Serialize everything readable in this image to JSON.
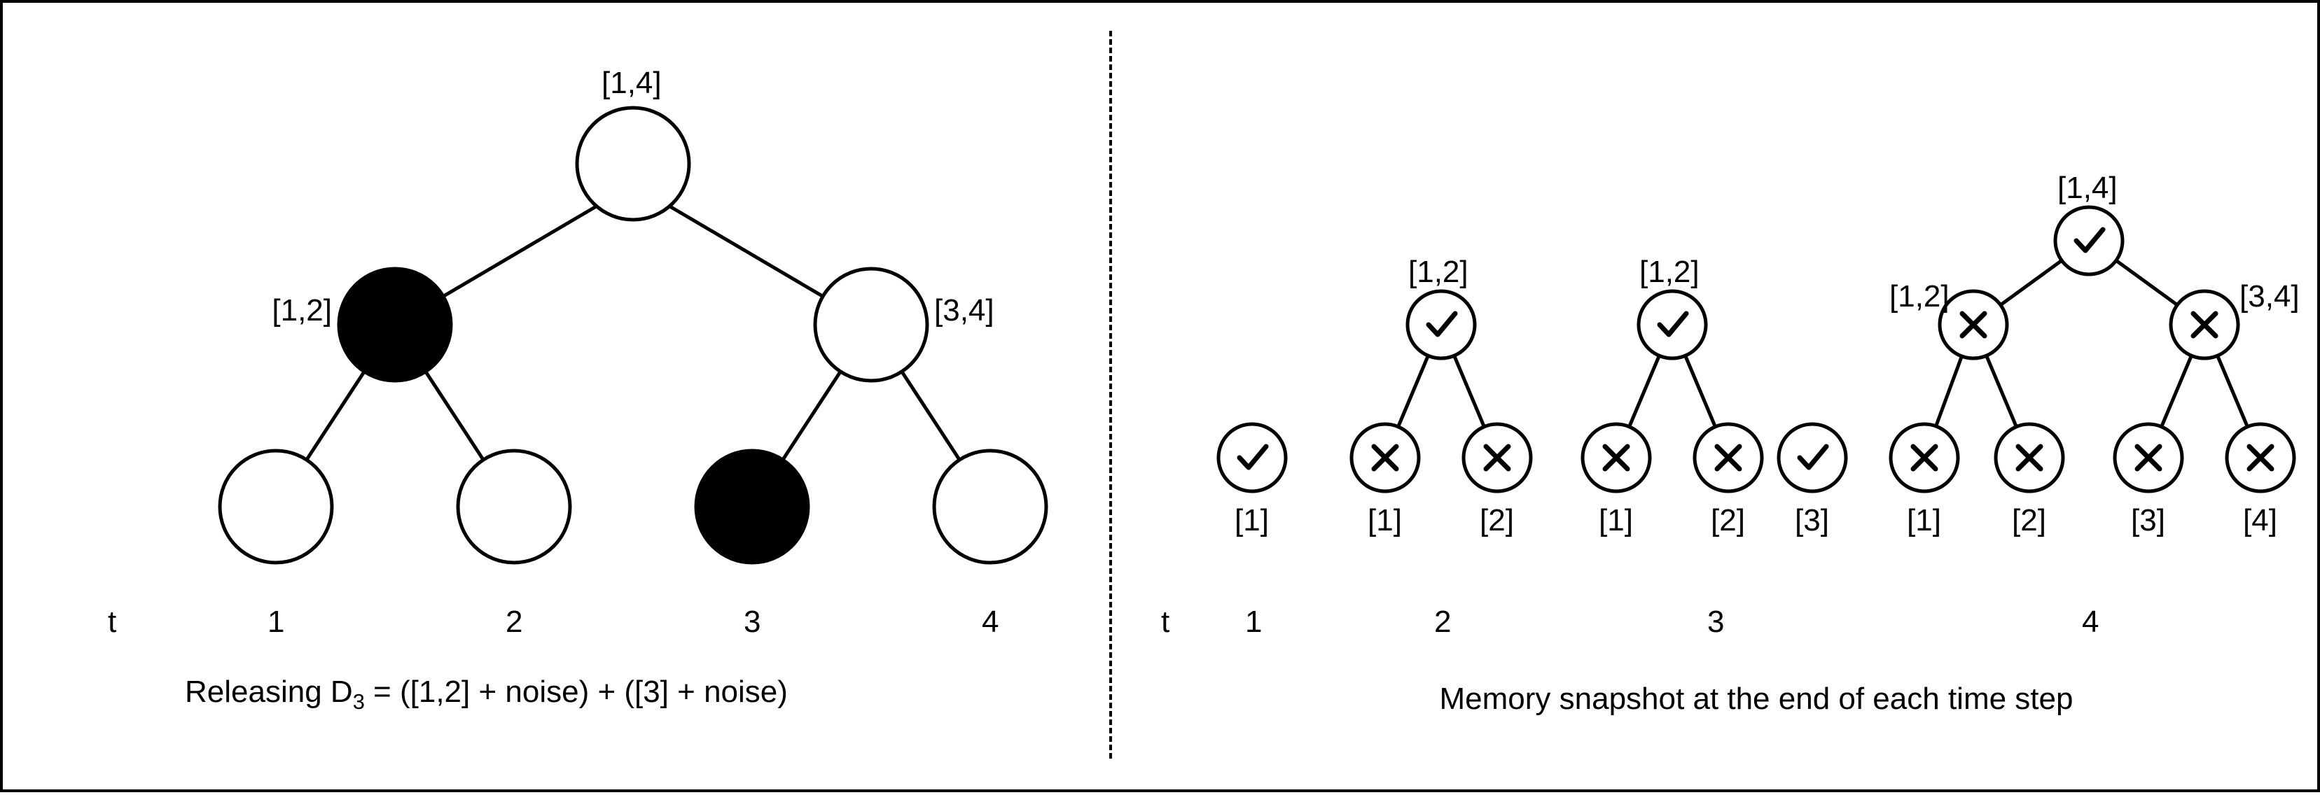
{
  "left": {
    "root_label": "[1,4]",
    "mid_left_label": "[1,2]",
    "mid_right_label": "[3,4]",
    "t_label": "t",
    "t1": "1",
    "t2": "2",
    "t3": "3",
    "t4": "4",
    "caption_prefix": "Releasing D",
    "caption_sub": "3",
    "caption_suffix": " = ([1,2] + noise) + ([3] + noise)",
    "nodes": {
      "root": {
        "filled": false
      },
      "m_l": {
        "filled": true
      },
      "m_r": {
        "filled": false
      },
      "leaf1": {
        "filled": false
      },
      "leaf2": {
        "filled": false
      },
      "leaf3": {
        "filled": true
      },
      "leaf4": {
        "filled": false
      }
    }
  },
  "right": {
    "t_label": "t",
    "t1": "1",
    "t2": "2",
    "t3": "3",
    "t4": "4",
    "caption": "Memory snapshot at the end of each time step",
    "snap1": {
      "leaf1": {
        "label": "[1]",
        "mark": "check"
      }
    },
    "snap2": {
      "top": {
        "label": "[1,2]",
        "mark": "check"
      },
      "leaf1": {
        "label": "[1]",
        "mark": "x"
      },
      "leaf2": {
        "label": "[2]",
        "mark": "x"
      }
    },
    "snap3": {
      "top": {
        "label": "[1,2]",
        "mark": "check"
      },
      "leaf1": {
        "label": "[1]",
        "mark": "x"
      },
      "leaf2": {
        "label": "[2]",
        "mark": "x"
      },
      "leaf3": {
        "label": "[3]",
        "mark": "check"
      }
    },
    "snap4": {
      "root": {
        "label": "[1,4]",
        "mark": "check"
      },
      "m_l": {
        "label": "[1,2]",
        "mark": "x"
      },
      "m_r": {
        "label": "[3,4]",
        "mark": "x"
      },
      "leaf1": {
        "label": "[1]",
        "mark": "x"
      },
      "leaf2": {
        "label": "[2]",
        "mark": "x"
      },
      "leaf3": {
        "label": "[3]",
        "mark": "x"
      },
      "leaf4": {
        "label": "[4]",
        "mark": "x"
      }
    }
  }
}
